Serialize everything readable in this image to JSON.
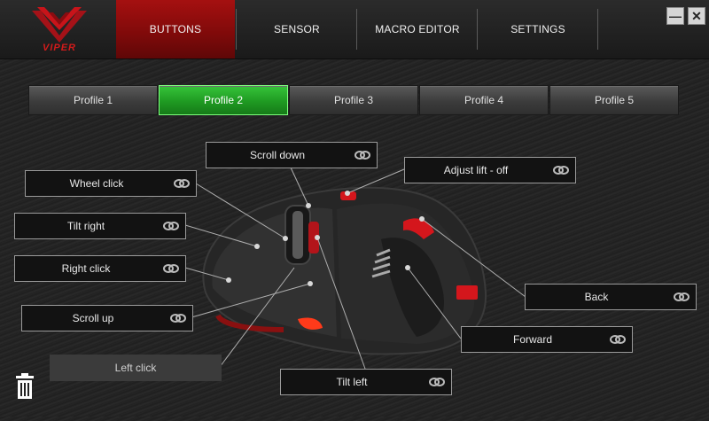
{
  "brand": {
    "logo_text": "VIPER",
    "accent": "#c8141a"
  },
  "tabs": [
    {
      "label": "BUTTONS",
      "active": true
    },
    {
      "label": "SENSOR",
      "active": false
    },
    {
      "label": "MACRO EDITOR",
      "active": false
    },
    {
      "label": "SETTINGS",
      "active": false
    }
  ],
  "window_controls": {
    "minimize": "minimize-icon",
    "close": "close-icon"
  },
  "profiles": [
    {
      "label": "Profile 1",
      "active": false
    },
    {
      "label": "Profile 2",
      "active": true
    },
    {
      "label": "Profile 3",
      "active": false
    },
    {
      "label": "Profile 4",
      "active": false
    },
    {
      "label": "Profile 5",
      "active": false
    }
  ],
  "button_assignments": {
    "scroll_down": "Scroll down",
    "adjust_lift": "Adjust lift - off",
    "wheel_click": "Wheel click",
    "tilt_right": "Tilt right",
    "right_click": "Right click",
    "scroll_up": "Scroll up",
    "left_click": "Left click",
    "tilt_left": "Tilt left",
    "back": "Back",
    "forward": "Forward"
  },
  "icons": {
    "link": "chain-link-icon",
    "trash": "trash-icon"
  },
  "colors": {
    "active_tab": "#a51010",
    "active_profile": "#22a826"
  }
}
